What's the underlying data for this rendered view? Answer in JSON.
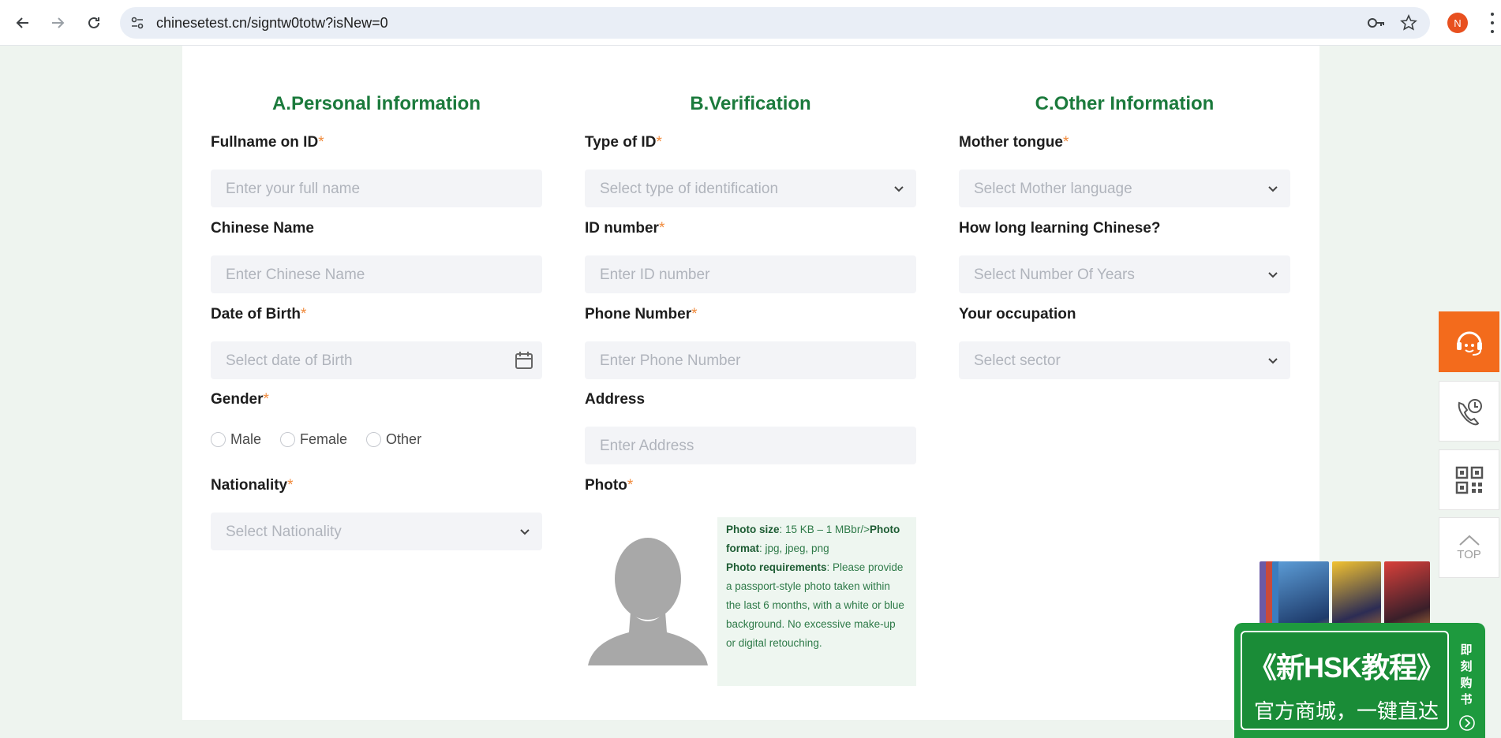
{
  "browser": {
    "url": "chinesetest.cn/signtw0totw?isNew=0",
    "profile_initial": "N"
  },
  "columns": {
    "personal": {
      "title": "A.Personal information",
      "fullname": {
        "label": "Fullname on ID",
        "required": "*",
        "placeholder": "Enter your full name"
      },
      "chinese_name": {
        "label": "Chinese Name",
        "placeholder": "Enter Chinese Name"
      },
      "dob": {
        "label": "Date of Birth",
        "required": "*",
        "placeholder": "Select date of Birth"
      },
      "gender": {
        "label": "Gender",
        "required": "*",
        "options": [
          "Male",
          "Female",
          "Other"
        ]
      },
      "nationality": {
        "label": "Nationality",
        "required": "*",
        "placeholder": "Select Nationality"
      }
    },
    "verification": {
      "title": "B.Verification",
      "id_type": {
        "label": "Type of ID",
        "required": "*",
        "placeholder": "Select type of identification"
      },
      "id_number": {
        "label": "ID number",
        "required": "*",
        "placeholder": "Enter ID number"
      },
      "phone": {
        "label": "Phone Number",
        "required": "*",
        "placeholder": "Enter Phone Number"
      },
      "address": {
        "label": "Address",
        "placeholder": "Enter Address"
      },
      "photo": {
        "label": "Photo",
        "required": "*",
        "size_label": "Photo size",
        "size_text": ": 15 KB – 1 MBbr/>",
        "format_label": "Photo format",
        "format_text": ": jpg, jpeg, png",
        "req_label": "Photo requirements",
        "req_text": ": Please provide a passport-style photo taken within the last 6 months, with a white or blue background. No excessive make-up or digital retouching."
      }
    },
    "other": {
      "title": "C.Other Information",
      "mother_tongue": {
        "label": "Mother tongue",
        "required": "*",
        "placeholder": "Select Mother language"
      },
      "learning": {
        "label": "How long learning Chinese?",
        "placeholder": "Select Number Of Years"
      },
      "occupation": {
        "label": "Your occupation",
        "placeholder": "Select sector"
      }
    }
  },
  "side_rail": {
    "top_label": "TOP"
  },
  "promo": {
    "title": "《新HSK教程》",
    "subtitle": "官方商城，一键直达",
    "side_text": "即刻购书"
  },
  "colors": {
    "accent_green": "#1b7a3c",
    "required_orange": "#f08a3c",
    "rail_orange": "#f36b1c"
  }
}
